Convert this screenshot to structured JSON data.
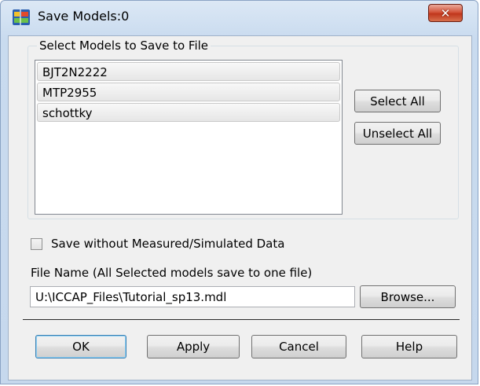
{
  "window": {
    "title": "Save Models:0",
    "close_label": "✕"
  },
  "models_group": {
    "label": "Select Models to Save to File",
    "items": [
      "BJT2N2222",
      "MTP2955",
      "schottky"
    ],
    "select_all_label": "Select All",
    "unselect_all_label": "Unselect All"
  },
  "options": {
    "save_without_data_label": "Save without Measured/Simulated Data",
    "save_without_data_checked": false
  },
  "file": {
    "label": "File Name (All Selected models save to one file)",
    "value": "U:\\ICCAP_Files\\Tutorial_sp13.mdl",
    "browse_label": "Browse..."
  },
  "footer": {
    "ok_label": "OK",
    "apply_label": "Apply",
    "cancel_label": "Cancel",
    "help_label": "Help"
  }
}
